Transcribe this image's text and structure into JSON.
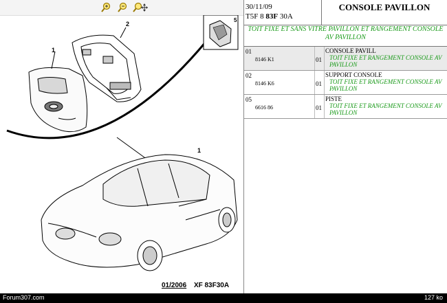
{
  "toolbar": {
    "icons": [
      "zoom-in-icon",
      "zoom-out-icon",
      "zoom-move-icon"
    ]
  },
  "diagram": {
    "callouts": [
      "1",
      "2",
      "1"
    ],
    "inset_label": "5",
    "footer_date": "01/2006",
    "footer_code": "XF 83F30A"
  },
  "header": {
    "date": "30/11/09",
    "code_prefix": "T5F 8",
    "code_bold": "83F",
    "code_suffix": "30A",
    "title": "CONSOLE PAVILLON"
  },
  "section_label": "TOIT FIXE ET SANS VITRE PAVILLON ET RANGEMENT CONSOLE AV PAVILLON",
  "parts": [
    {
      "index": "01",
      "ref": "8146 K1",
      "qty": "01",
      "name": "CONSOLE PAVILL",
      "subtitle": "TOIT FIXE ET RANGEMENT CONSOLE AV PAVILLON",
      "selected": true
    },
    {
      "index": "02",
      "ref": "8146 K6",
      "qty": "01",
      "name": "SUPPORT CONSOLE",
      "subtitle": "TOIT FIXE ET RANGEMENT CONSOLE AV PAVILLON",
      "selected": false
    },
    {
      "index": "05",
      "ref": "6616 86",
      "qty": "01",
      "name": "PISTE",
      "subtitle": "TOIT FIXE ET RANGEMENT CONSOLE AV PAVILLON",
      "selected": false
    }
  ],
  "status": {
    "left": "Forum307.com",
    "right": "127 ko"
  }
}
